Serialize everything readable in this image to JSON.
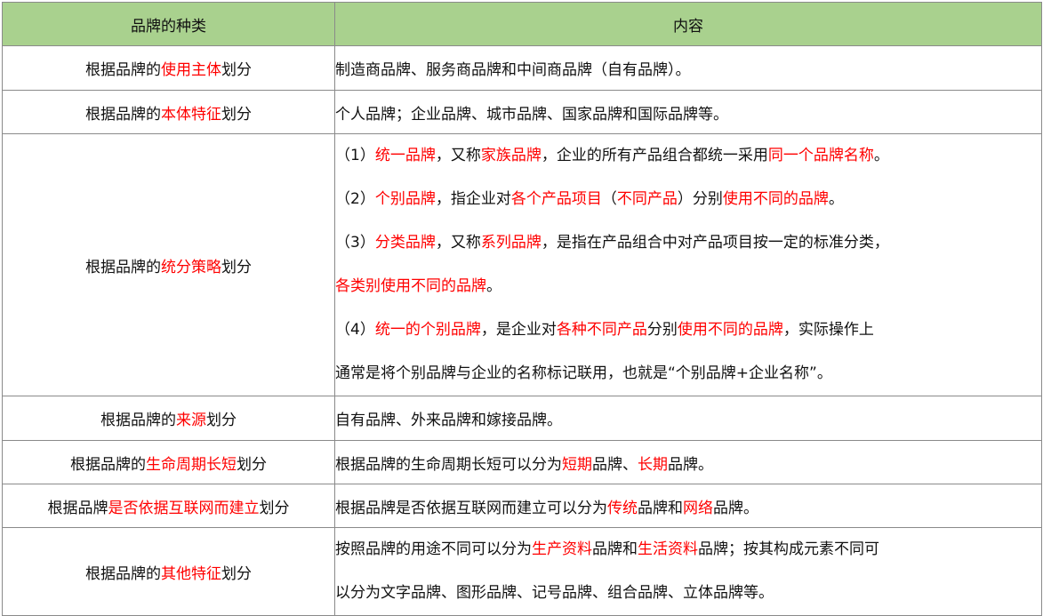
{
  "header": {
    "col1": "品牌的种类",
    "col2": "内容"
  },
  "rows": [
    {
      "category": [
        {
          "t": "根据品牌的",
          "h": false
        },
        {
          "t": "使用主体",
          "h": true
        },
        {
          "t": "划分",
          "h": false
        }
      ],
      "content": [
        [
          {
            "t": "制造商品牌、服务商品牌和中间商品牌（自有品牌）。",
            "h": false
          }
        ]
      ],
      "height": 50
    },
    {
      "category": [
        {
          "t": "根据品牌的",
          "h": false
        },
        {
          "t": "本体特征",
          "h": true
        },
        {
          "t": "划分",
          "h": false
        }
      ],
      "content": [
        [
          {
            "t": "个人品牌；企业品牌、城市品牌、国家品牌和国际品牌等。",
            "h": false
          }
        ]
      ],
      "height": 49
    },
    {
      "category": [
        {
          "t": "根据品牌的",
          "h": false
        },
        {
          "t": "统分策略",
          "h": true
        },
        {
          "t": "划分",
          "h": false
        }
      ],
      "content": [
        [
          {
            "t": "（1）",
            "h": false
          },
          {
            "t": "统一品牌",
            "h": true
          },
          {
            "t": "，又称",
            "h": false
          },
          {
            "t": "家族品牌",
            "h": true
          },
          {
            "t": "，企业的所有产品组合都统一采用",
            "h": false
          },
          {
            "t": "同一个品牌名称",
            "h": true
          },
          {
            "t": "。",
            "h": false
          }
        ],
        [
          {
            "t": "（2）",
            "h": false
          },
          {
            "t": "个别品牌",
            "h": true
          },
          {
            "t": "，指企业对",
            "h": false
          },
          {
            "t": "各个产品项目",
            "h": true
          },
          {
            "t": "（",
            "h": false
          },
          {
            "t": "不同产品",
            "h": true
          },
          {
            "t": "）分别",
            "h": false
          },
          {
            "t": "使用不同的品牌",
            "h": true
          },
          {
            "t": "。",
            "h": false
          }
        ],
        [
          {
            "t": "（3）",
            "h": false
          },
          {
            "t": "分类品牌",
            "h": true
          },
          {
            "t": "，又称",
            "h": false
          },
          {
            "t": "系列品牌",
            "h": true
          },
          {
            "t": "，是指在产品组合中对产品项目按一定的标准分类，",
            "h": false
          }
        ],
        [
          {
            "t": "各类别使用不同的品牌",
            "h": true
          },
          {
            "t": "。",
            "h": false
          }
        ],
        [
          {
            "t": "（4）",
            "h": false
          },
          {
            "t": "统一的个别品牌",
            "h": true
          },
          {
            "t": "，是企业对",
            "h": false
          },
          {
            "t": "各种不同产品",
            "h": true
          },
          {
            "t": "分别",
            "h": false
          },
          {
            "t": "使用不同的品牌",
            "h": true
          },
          {
            "t": "，实际操作上",
            "h": false
          }
        ],
        [
          {
            "t": "通常是将个别品牌与企业的名称标记联用，也就是“个别品牌+企业名称”。",
            "h": false
          }
        ]
      ],
      "height": 287
    },
    {
      "category": [
        {
          "t": "根据品牌的",
          "h": false
        },
        {
          "t": "来源",
          "h": true
        },
        {
          "t": "划分",
          "h": false
        }
      ],
      "content": [
        [
          {
            "t": "自有品牌、外来品牌和嫁接品牌。",
            "h": false
          }
        ]
      ],
      "height": 50
    },
    {
      "category": [
        {
          "t": "根据品牌的",
          "h": false
        },
        {
          "t": "生命周期长短",
          "h": true
        },
        {
          "t": "划分",
          "h": false
        }
      ],
      "content": [
        [
          {
            "t": "根据品牌的生命周期长短可以分为",
            "h": false
          },
          {
            "t": "短期",
            "h": true
          },
          {
            "t": "品牌、",
            "h": false
          },
          {
            "t": "长期",
            "h": true
          },
          {
            "t": "品牌。",
            "h": false
          }
        ]
      ],
      "height": 49
    },
    {
      "category": [
        {
          "t": "根据品牌",
          "h": false
        },
        {
          "t": "是否依据互联网而建立",
          "h": true
        },
        {
          "t": "划分",
          "h": false
        }
      ],
      "content": [
        [
          {
            "t": "根据品牌是否依据互联网而建立可以分为",
            "h": false
          },
          {
            "t": "传统",
            "h": true
          },
          {
            "t": "品牌和",
            "h": false
          },
          {
            "t": "网络",
            "h": true
          },
          {
            "t": "品牌。",
            "h": false
          }
        ]
      ],
      "height": 49
    },
    {
      "category": [
        {
          "t": "根据品牌的",
          "h": false
        },
        {
          "t": "其他特征",
          "h": true
        },
        {
          "t": "划分",
          "h": false
        }
      ],
      "content": [
        [
          {
            "t": "按照品牌的用途不同可以分为",
            "h": false
          },
          {
            "t": "生产资料",
            "h": true
          },
          {
            "t": "品牌和",
            "h": false
          },
          {
            "t": "生活资料",
            "h": true
          },
          {
            "t": "品牌；按其构成元素不同可",
            "h": false
          }
        ],
        [
          {
            "t": "以分为文字品牌、图形品牌、记号品牌、组合品牌、立体品牌等。",
            "h": false
          }
        ]
      ],
      "height": 97
    }
  ],
  "colors": {
    "header_bg": "#a9d18e",
    "highlight": "#ff0000",
    "border": "#8a8a8a",
    "text": "#111111"
  }
}
